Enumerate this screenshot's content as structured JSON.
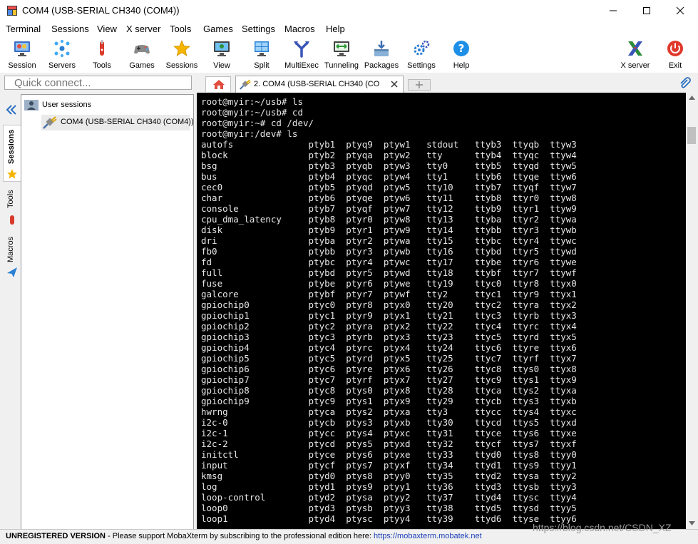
{
  "window": {
    "title": "COM4  (USB-SERIAL CH340 (COM4))"
  },
  "menu": [
    "Terminal",
    "Sessions",
    "View",
    "X server",
    "Tools",
    "Games",
    "Settings",
    "Macros",
    "Help"
  ],
  "toolbar": {
    "session": "Session",
    "servers": "Servers",
    "tools": "Tools",
    "games": "Games",
    "sessions": "Sessions",
    "view": "View",
    "split": "Split",
    "multiexec": "MultiExec",
    "tunneling": "Tunneling",
    "packages": "Packages",
    "settings": "Settings",
    "help": "Help",
    "xserver": "X server",
    "exit": "Exit"
  },
  "quick_connect": {
    "placeholder": "Quick connect..."
  },
  "side_tabs": [
    "Sessions",
    "Tools",
    "Macros"
  ],
  "sessions_panel": {
    "root_label": "User sessions",
    "session_item": "COM4  (USB-SERIAL CH340 (COM4))"
  },
  "tab": {
    "label": "2. COM4  (USB-SERIAL CH340 (CO"
  },
  "terminal": {
    "lines": [
      "root@myir:~/usb# ls",
      "root@myir:~/usb# cd",
      "root@myir:~# cd /dev/",
      "root@myir:/dev# ls",
      "autofs              ptyb1  ptyq9  ptyw1   stdout   ttyb3  ttyqb  ttyw3",
      "block               ptyb2  ptyqa  ptyw2   tty      ttyb4  ttyqc  ttyw4",
      "bsg                 ptyb3  ptyqb  ptyw3   tty0     ttyb5  ttyqd  ttyw5",
      "bus                 ptyb4  ptyqc  ptyw4   tty1     ttyb6  ttyqe  ttyw6",
      "cec0                ptyb5  ptyqd  ptyw5   tty10    ttyb7  ttyqf  ttyw7",
      "char                ptyb6  ptyqe  ptyw6   tty11    ttyb8  ttyr0  ttyw8",
      "console             ptyb7  ptyqf  ptyw7   tty12    ttyb9  ttyr1  ttyw9",
      "cpu_dma_latency     ptyb8  ptyr0  ptyw8   tty13    ttyba  ttyr2  ttywa",
      "disk                ptyb9  ptyr1  ptyw9   tty14    ttybb  ttyr3  ttywb",
      "dri                 ptyba  ptyr2  ptywa   tty15    ttybc  ttyr4  ttywc",
      "fb0                 ptybb  ptyr3  ptywb   tty16    ttybd  ttyr5  ttywd",
      "fd                  ptybc  ptyr4  ptywc   tty17    ttybe  ttyr6  ttywe",
      "full                ptybd  ptyr5  ptywd   tty18    ttybf  ttyr7  ttywf",
      "fuse                ptybe  ptyr6  ptywe   tty19    ttyc0  ttyr8  ttyx0",
      "galcore             ptybf  ptyr7  ptywf   tty2     ttyc1  ttyr9  ttyx1",
      "gpiochip0           ptyc0  ptyr8  ptyx0   tty20    ttyc2  ttyra  ttyx2",
      "gpiochip1           ptyc1  ptyr9  ptyx1   tty21    ttyc3  ttyrb  ttyx3",
      "gpiochip2           ptyc2  ptyra  ptyx2   tty22    ttyc4  ttyrc  ttyx4",
      "gpiochip3           ptyc3  ptyrb  ptyx3   tty23    ttyc5  ttyrd  ttyx5",
      "gpiochip4           ptyc4  ptyrc  ptyx4   tty24    ttyc6  ttyre  ttyx6",
      "gpiochip5           ptyc5  ptyrd  ptyx5   tty25    ttyc7  ttyrf  ttyx7",
      "gpiochip6           ptyc6  ptyre  ptyx6   tty26    ttyc8  ttys0  ttyx8",
      "gpiochip7           ptyc7  ptyrf  ptyx7   tty27    ttyc9  ttys1  ttyx9",
      "gpiochip8           ptyc8  ptys0  ptyx8   tty28    ttyca  ttys2  ttyxa",
      "gpiochip9           ptyc9  ptys1  ptyx9   tty29    ttycb  ttys3  ttyxb",
      "hwrng               ptyca  ptys2  ptyxa   tty3     ttycc  ttys4  ttyxc",
      "i2c-0               ptycb  ptys3  ptyxb   tty30    ttycd  ttys5  ttyxd",
      "i2c-1               ptycc  ptys4  ptyxc   tty31    ttyce  ttys6  ttyxe",
      "i2c-2               ptycd  ptys5  ptyxd   tty32    ttycf  ttys7  ttyxf",
      "initctl             ptyce  ptys6  ptyxe   tty33    ttyd0  ttys8  ttyy0",
      "input               ptycf  ptys7  ptyxf   tty34    ttyd1  ttys9  ttyy1",
      "kmsg                ptyd0  ptys8  ptyy0   tty35    ttyd2  ttysa  ttyy2",
      "log                 ptyd1  ptys9  ptyy1   tty36    ttyd3  ttysb  ttyy3",
      "loop-control        ptyd2  ptysa  ptyy2   tty37    ttyd4  ttysc  ttyy4",
      "loop0               ptyd3  ptysb  ptyy3   tty38    ttyd5  ttysd  ttyy5",
      "loop1               ptyd4  ptysc  ptyy4   tty39    ttyd6  ttyse  ttyy6"
    ]
  },
  "status": {
    "unregistered": "UNREGISTERED VERSION",
    "message": "  -  Please support MobaXterm by subscribing to the professional edition here: ",
    "link": "https://mobaxterm.mobatek.net"
  },
  "watermark": "https://blog.csdn.net/CSDN_XZ"
}
